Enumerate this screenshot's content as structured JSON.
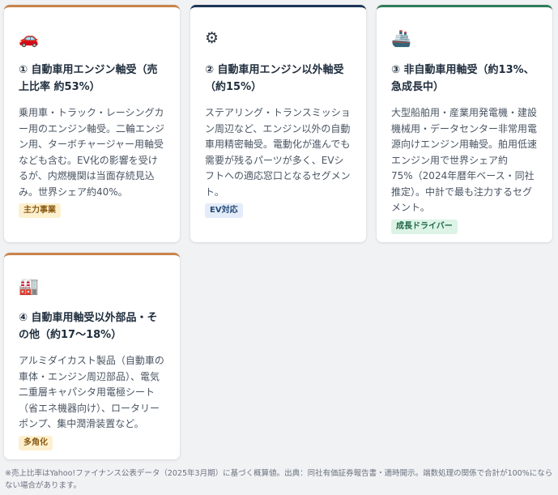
{
  "cards": [
    {
      "icon": "car-icon",
      "icon_glyph": "🚗",
      "title": "① 自動車用エンジン軸受（売上比率 約53%）",
      "description": "乗用車・トラック・レーシングカー用のエンジン軸受。二輪エンジン用、ターボチャージャー用軸受なども含む。EV化の影響を受けるが、内燃機関は当面存続見込み。世界シェア約40%。",
      "badge": "主力事業",
      "accent": "#c8834a"
    },
    {
      "icon": "gear-icon",
      "icon_glyph": "⚙",
      "title": "② 自動車用エンジン以外軸受（約15%）",
      "description": "ステアリング・トランスミッション周辺など、エンジン以外の自動車用精密軸受。電動化が進んでも需要が残るパーツが多く、EVシフトへの適応窓口となるセグメント。",
      "badge": "EV対応",
      "accent": "#1d3557"
    },
    {
      "icon": "ship-icon",
      "icon_glyph": "🚢",
      "title": "③ 非自動車用軸受（約13%、急成長中）",
      "description": "大型船舶用・産業用発電機・建設機械用・データセンター非常用電源向けエンジン用軸受。舶用低速エンジン用で世界シェア約75%（2024年暦年ベース・同社推定）。中計で最も注力するセグメント。",
      "badge": "成長ドライバー",
      "accent": "#2e7d5b"
    },
    {
      "icon": "factory-icon",
      "icon_glyph": "🏭",
      "title": "④ 自動車用軸受以外部品・その他（約17〜18%）",
      "description": "アルミダイカスト製品（自動車の車体・エンジン周辺部品）、電気二重層キャパシタ用電極シート（省エネ機器向け）、ロータリーポンプ、集中潤滑装置など。",
      "badge": "多角化",
      "accent": "#c8834a"
    }
  ],
  "footnote": "※売上比率はYahoo!ファイナンス公表データ（2025年3月期）に基づく概算値。出典：同社有価証券報告書・適時開示。端数処理の関係で合計が100%にならない場合があります。"
}
